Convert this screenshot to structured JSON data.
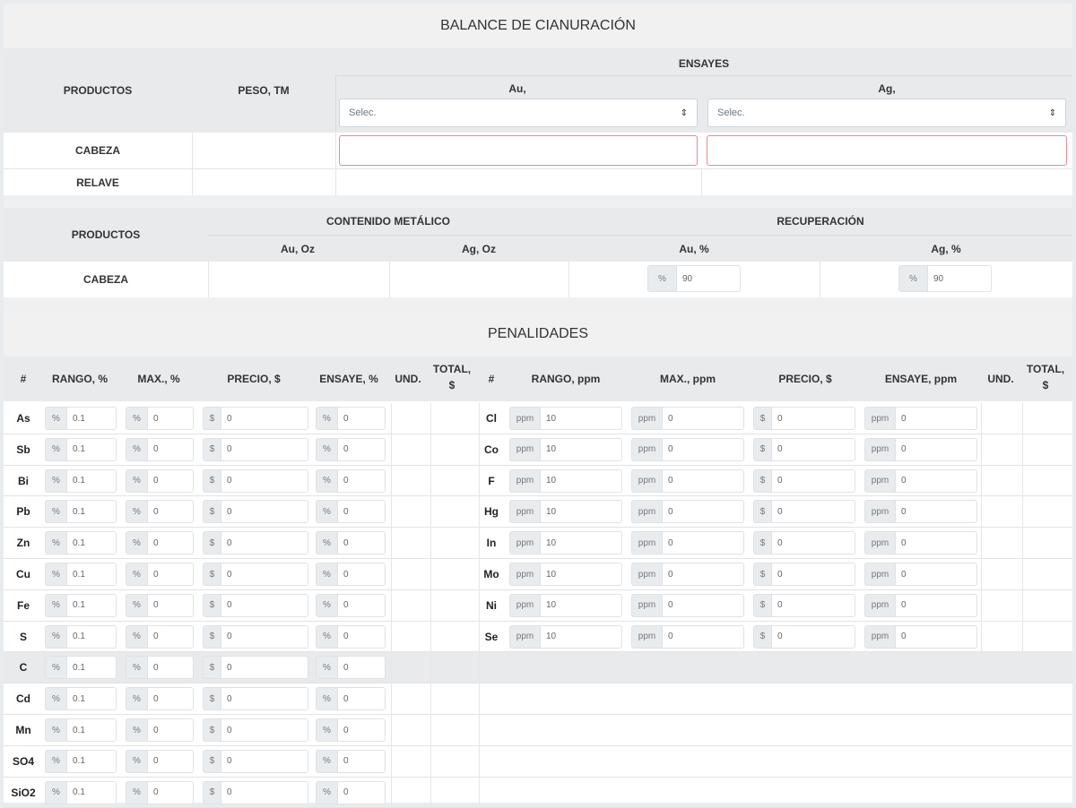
{
  "balance": {
    "title": "BALANCE DE CIANURACIÓN",
    "col_productos": "PRODUCTOS",
    "col_peso": "PESO, TM",
    "ensayes": "ENSAYES",
    "au_label": "Au,",
    "ag_label": "Ag,",
    "au_select": "Selec.",
    "ag_select": "Selec.",
    "rows": [
      "CABEZA",
      "RELAVE"
    ]
  },
  "metal": {
    "col_productos": "PRODUCTOS",
    "contenido": "CONTENIDO METÁLICO",
    "recuperacion": "RECUPERACIÓN",
    "au_oz": "Au, Oz",
    "ag_oz": "Ag, Oz",
    "au_pct": "Au, %",
    "ag_pct": "Ag, %",
    "row": "CABEZA",
    "au_rec_prefix": "%",
    "au_rec_value": "90",
    "ag_rec_prefix": "%",
    "ag_rec_value": "90"
  },
  "penal": {
    "title": "PENALIDADES",
    "left_headers": {
      "num": "#",
      "rango": "RANGO, %",
      "max": "MAX., %",
      "precio": "PRECIO, $",
      "ensaye": "ENSAYE, %",
      "und": "UND.",
      "total1": "TOTAL,",
      "total2": "$"
    },
    "right_headers": {
      "num": "#",
      "rango": "RANGO, ppm",
      "max": "MAX., ppm",
      "precio": "PRECIO, $",
      "ensaye": "ENSAYE, ppm",
      "und": "UND.",
      "total1": "TOTAL,",
      "total2": "$"
    },
    "left_prefixes": {
      "rango": "%",
      "max": "%",
      "precio": "$",
      "ensaye": "%"
    },
    "right_prefixes": {
      "rango": "ppm",
      "max": "ppm",
      "precio": "$",
      "ensaye": "ppm"
    },
    "left_rows": [
      {
        "el": "As",
        "rango": "0.1",
        "max": "0",
        "precio": "0",
        "ensaye": "0"
      },
      {
        "el": "Sb",
        "rango": "0.1",
        "max": "0",
        "precio": "0",
        "ensaye": "0"
      },
      {
        "el": "Bi",
        "rango": "0.1",
        "max": "0",
        "precio": "0",
        "ensaye": "0"
      },
      {
        "el": "Pb",
        "rango": "0.1",
        "max": "0",
        "precio": "0",
        "ensaye": "0"
      },
      {
        "el": "Zn",
        "rango": "0.1",
        "max": "0",
        "precio": "0",
        "ensaye": "0"
      },
      {
        "el": "Cu",
        "rango": "0.1",
        "max": "0",
        "precio": "0",
        "ensaye": "0"
      },
      {
        "el": "Fe",
        "rango": "0.1",
        "max": "0",
        "precio": "0",
        "ensaye": "0"
      },
      {
        "el": "S",
        "rango": "0.1",
        "max": "0",
        "precio": "0",
        "ensaye": "0"
      },
      {
        "el": "C",
        "rango": "0.1",
        "max": "0",
        "precio": "0",
        "ensaye": "0"
      },
      {
        "el": "Cd",
        "rango": "0.1",
        "max": "0",
        "precio": "0",
        "ensaye": "0"
      },
      {
        "el": "Mn",
        "rango": "0.1",
        "max": "0",
        "precio": "0",
        "ensaye": "0"
      },
      {
        "el": "SO4",
        "rango": "0.1",
        "max": "0",
        "precio": "0",
        "ensaye": "0"
      },
      {
        "el": "SiO2",
        "rango": "0.1",
        "max": "0",
        "precio": "0",
        "ensaye": "0"
      }
    ],
    "right_rows": [
      {
        "el": "Cl",
        "rango": "10",
        "max": "0",
        "precio": "0",
        "ensaye": "0"
      },
      {
        "el": "Co",
        "rango": "10",
        "max": "0",
        "precio": "0",
        "ensaye": "0"
      },
      {
        "el": "F",
        "rango": "10",
        "max": "0",
        "precio": "0",
        "ensaye": "0"
      },
      {
        "el": "Hg",
        "rango": "10",
        "max": "0",
        "precio": "0",
        "ensaye": "0"
      },
      {
        "el": "In",
        "rango": "10",
        "max": "0",
        "precio": "0",
        "ensaye": "0"
      },
      {
        "el": "Mo",
        "rango": "10",
        "max": "0",
        "precio": "0",
        "ensaye": "0"
      },
      {
        "el": "Ni",
        "rango": "10",
        "max": "0",
        "precio": "0",
        "ensaye": "0"
      },
      {
        "el": "Se",
        "rango": "10",
        "max": "0",
        "precio": "0",
        "ensaye": "0"
      }
    ]
  }
}
